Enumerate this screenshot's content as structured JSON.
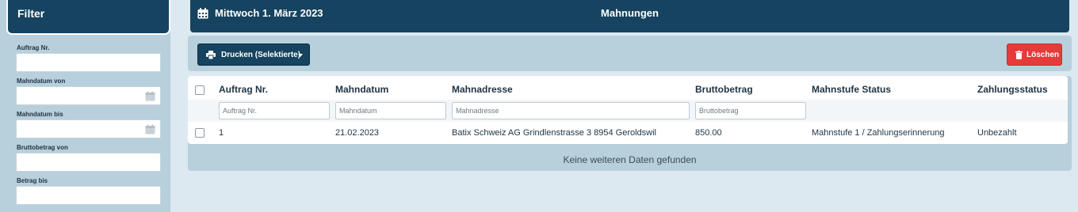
{
  "sidebar": {
    "title": "Filter",
    "fields": [
      {
        "label": "Auftrag Nr.",
        "has_calendar": false
      },
      {
        "label": "Mahndatum von",
        "has_calendar": true
      },
      {
        "label": "Mahndatum bis",
        "has_calendar": true
      },
      {
        "label": "Bruttobetrag von",
        "has_calendar": false
      },
      {
        "label": "Betrag bis",
        "has_calendar": false
      }
    ]
  },
  "header": {
    "date": "Mittwoch 1. März 2023",
    "title": "Mahnungen"
  },
  "toolbar": {
    "print_label": "Drucken (Selektierte)",
    "delete_label": "Löschen"
  },
  "table": {
    "columns": [
      "Auftrag Nr.",
      "Mahndatum",
      "Mahnadresse",
      "Bruttobetrag",
      "Mahnstufe Status",
      "Zahlungsstatus"
    ],
    "filters": {
      "auftrag": "Auftrag Nr.",
      "mahndatum": "Mahndatum",
      "mahnadresse": "Mahnadresse",
      "bruttobetrag": "Bruttobetrag"
    },
    "rows": [
      {
        "auftrag": "1",
        "mahndatum": "21.02.2023",
        "mahnadresse": "Batix Schweiz AG Grindlenstrasse 3 8954 Geroldswil",
        "bruttobetrag": "850.00",
        "mahnstufe": "Mahnstufe 1 / Zahlungserinnerung",
        "zahlungsstatus": "Unbezahlt"
      }
    ],
    "footer_message": "Keine weiteren Daten gefunden"
  },
  "colors": {
    "primary": "#16435f",
    "danger": "#e53b3b",
    "panel": "#b8cfdc",
    "background": "#dce9f1"
  }
}
